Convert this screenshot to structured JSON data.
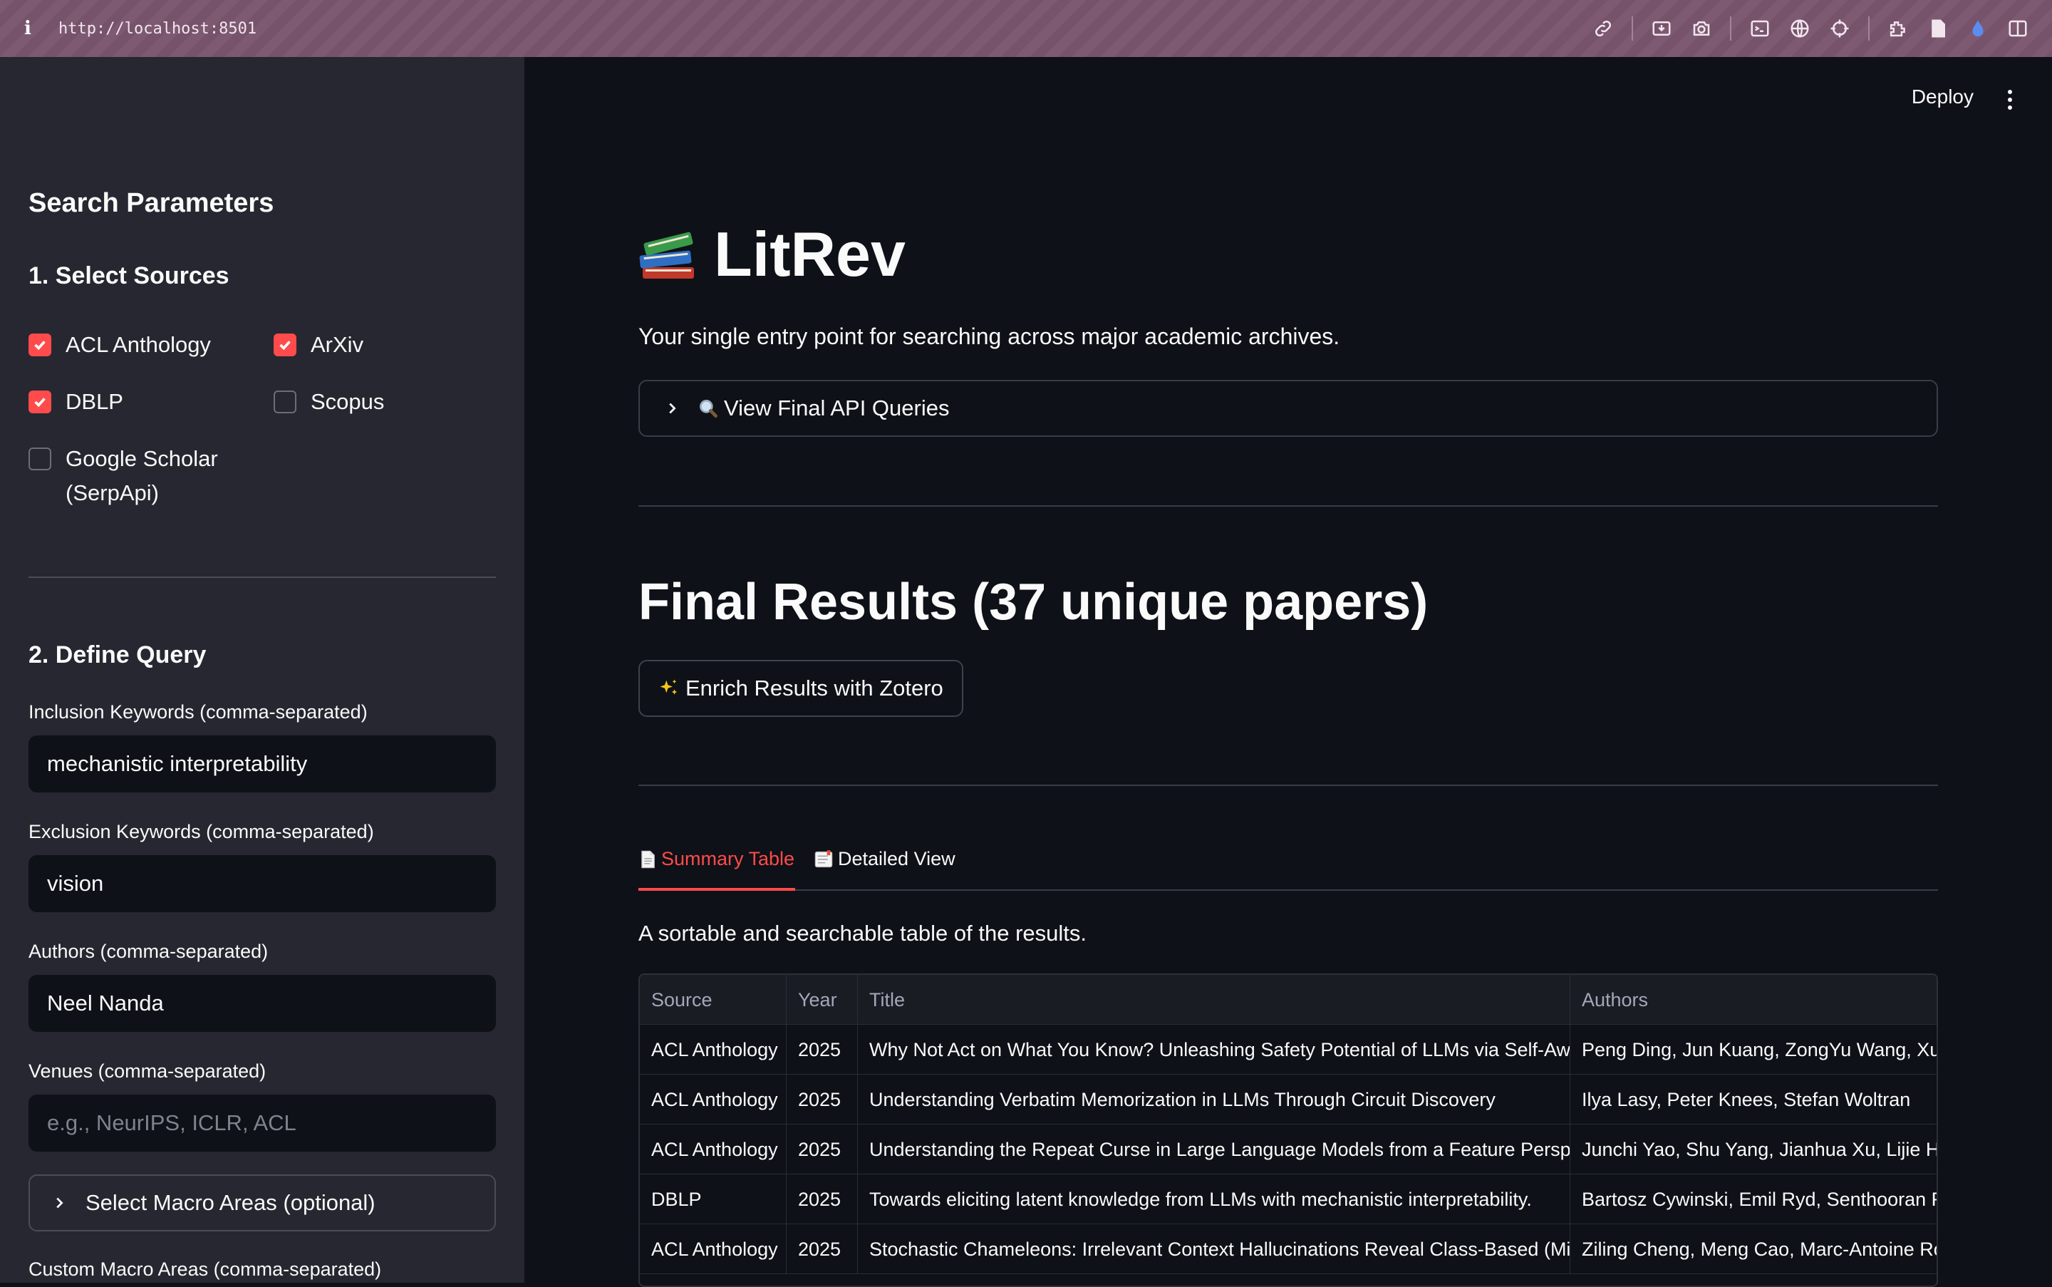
{
  "browser": {
    "url": "http://localhost:8501",
    "info_glyph": "i"
  },
  "sidebar": {
    "heading": "Search Parameters",
    "sources_heading": "1. Select Sources",
    "sources": [
      {
        "label": "ACL Anthology",
        "checked": true
      },
      {
        "label": "ArXiv",
        "checked": true
      },
      {
        "label": "DBLP",
        "checked": true
      },
      {
        "label": "Scopus",
        "checked": false
      },
      {
        "label_line1": "Google Scholar",
        "label_line2": "(SerpApi)",
        "checked": false
      }
    ],
    "query_heading": "2. Define Query",
    "inclusion": {
      "label": "Inclusion Keywords (comma-separated)",
      "value": "mechanistic interpretability"
    },
    "exclusion": {
      "label": "Exclusion Keywords (comma-separated)",
      "value": "vision"
    },
    "authors": {
      "label": "Authors (comma-separated)",
      "value": "Neel Nanda"
    },
    "venues": {
      "label": "Venues (comma-separated)",
      "placeholder": "e.g., NeurIPS, ICLR, ACL"
    },
    "macro_areas_expander": "Select Macro Areas (optional)",
    "custom_macro_label": "Custom Macro Areas (comma-separated)"
  },
  "header": {
    "deploy_label": "Deploy"
  },
  "main": {
    "title": "LitRev",
    "subtitle": "Your single entry point for searching across major academic archives.",
    "api_expander": "View Final API Queries",
    "results_heading": "Final Results (37 unique papers)",
    "enrich_button": "Enrich Results with Zotero",
    "tabs": [
      {
        "label": "Summary Table",
        "active": true
      },
      {
        "label": "Detailed View",
        "active": false
      }
    ],
    "caption": "A sortable and searchable table of the results.",
    "table": {
      "columns": [
        "Source",
        "Year",
        "Title",
        "Authors"
      ],
      "rows": [
        [
          "ACL Anthology",
          "2025",
          "Why Not Act on What You Know? Unleashing Safety Potential of LLMs via Self-Aware Guarding Interventions",
          "Peng Ding, Jun Kuang, ZongYu Wang, Xuezhi Cao"
        ],
        [
          "ACL Anthology",
          "2025",
          "Understanding Verbatim Memorization in LLMs Through Circuit Discovery",
          "Ilya Lasy, Peter Knees, Stefan Woltran"
        ],
        [
          "ACL Anthology",
          "2025",
          "Understanding the Repeat Curse in Large Language Models from a Feature Perspective",
          "Junchi Yao, Shu Yang, Jianhua Xu, Lijie Hu, Mengdi Li"
        ],
        [
          "DBLP",
          "2025",
          "Towards eliciting latent knowledge from LLMs with mechanistic interpretability.",
          "Bartosz Cywinski, Emil Ryd, Senthooran Rajamanoharan"
        ],
        [
          "ACL Anthology",
          "2025",
          "Stochastic Chameleons: Irrelevant Context Hallucinations Reveal Class-Based (Mis)Generalization in LLMs",
          "Ziling Cheng, Meng Cao, Marc-Antoine Rondeau"
        ]
      ]
    }
  },
  "colors": {
    "accent": "#ff4b4b",
    "sidebar_bg": "#262730",
    "main_bg": "#0e1117",
    "browser_bar": "#7e5a72"
  }
}
